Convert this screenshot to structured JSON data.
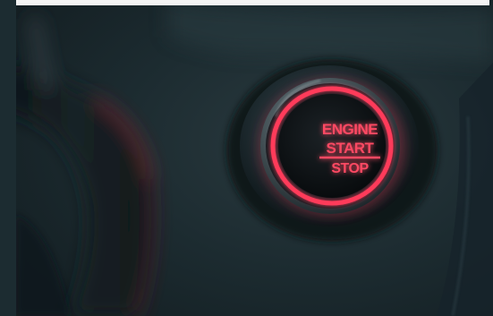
{
  "scene": {
    "subject": "engine-start-stop-button",
    "ring_color": "#ff3b5a",
    "label_color": "#ff4a63",
    "background_color": "#1b2b30"
  },
  "button": {
    "line1": "ENGINE",
    "line2": "START",
    "line3": "STOP"
  }
}
